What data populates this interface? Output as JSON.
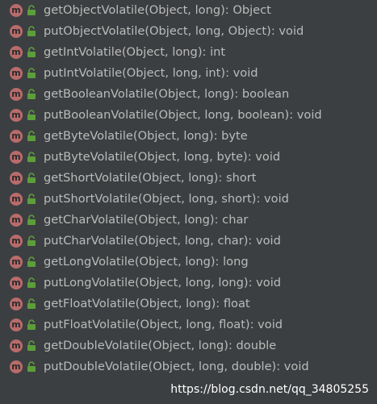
{
  "badge_letter": "m",
  "colors": {
    "background": "#3c3f41",
    "text": "#bbbbbb",
    "method_badge": "#b96b6b",
    "lock": "#5c9e3a"
  },
  "icons": {
    "method": "method-icon",
    "access": "public-lock-icon"
  },
  "methods": [
    "getObjectVolatile(Object, long): Object",
    "putObjectVolatile(Object, long, Object): void",
    "getIntVolatile(Object, long): int",
    "putIntVolatile(Object, long, int): void",
    "getBooleanVolatile(Object, long): boolean",
    "putBooleanVolatile(Object, long, boolean): void",
    "getByteVolatile(Object, long): byte",
    "putByteVolatile(Object, long, byte): void",
    "getShortVolatile(Object, long): short",
    "putShortVolatile(Object, long, short): void",
    "getCharVolatile(Object, long): char",
    "putCharVolatile(Object, long, char): void",
    "getLongVolatile(Object, long): long",
    "putLongVolatile(Object, long, long): void",
    "getFloatVolatile(Object, long): float",
    "putFloatVolatile(Object, long, float): void",
    "getDoubleVolatile(Object, long): double",
    "putDoubleVolatile(Object, long, double): void"
  ],
  "watermark": "https://blog.csdn.net/qq_34805255"
}
